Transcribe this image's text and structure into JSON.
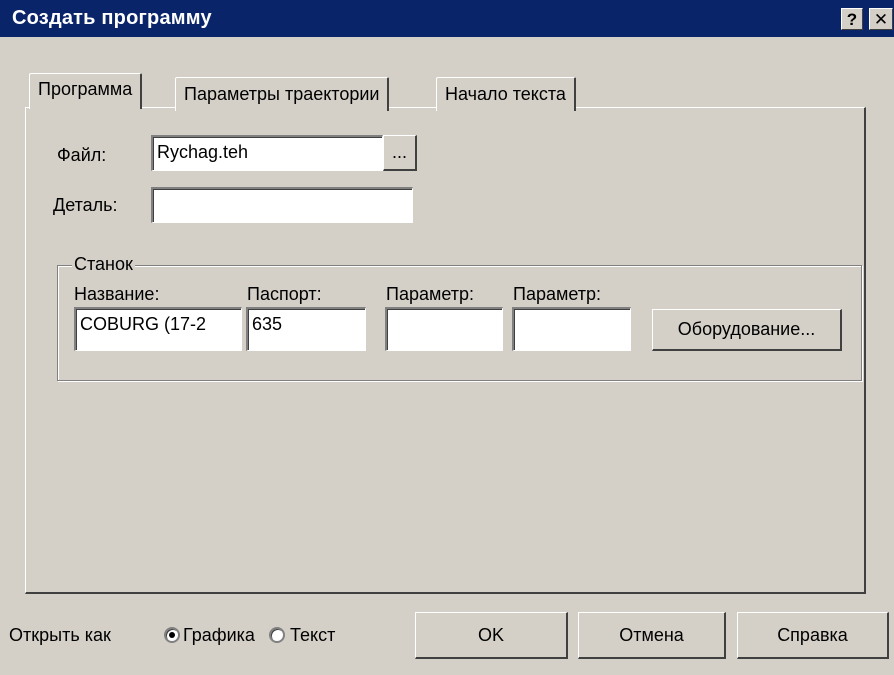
{
  "window": {
    "title": "Создать программу",
    "help_label": "?",
    "close_label": "✕"
  },
  "tabs": [
    {
      "label": "Программа",
      "active": true
    },
    {
      "label": "Параметры траектории",
      "active": false
    },
    {
      "label": "Начало текста",
      "active": false
    }
  ],
  "form": {
    "file_label": "Файл:",
    "file_value": "Rychag.teh",
    "browse_label": "...",
    "part_label": "Деталь:",
    "part_value": ""
  },
  "machine": {
    "group_label": "Станок",
    "name_label": "Название:",
    "name_value": "COBURG (17-2",
    "passport_label": "Паспорт:",
    "passport_value": "635",
    "param1_label": "Параметр:",
    "param1_value": "",
    "param2_label": "Параметр:",
    "param2_value": "",
    "equipment_button": "Оборудование..."
  },
  "footer": {
    "open_as_label": "Открыть как",
    "options": [
      {
        "label": "Графика",
        "selected": true
      },
      {
        "label": "Текст",
        "selected": false
      }
    ],
    "ok_label": "OK",
    "cancel_label": "Отмена",
    "help_label": "Справка"
  }
}
